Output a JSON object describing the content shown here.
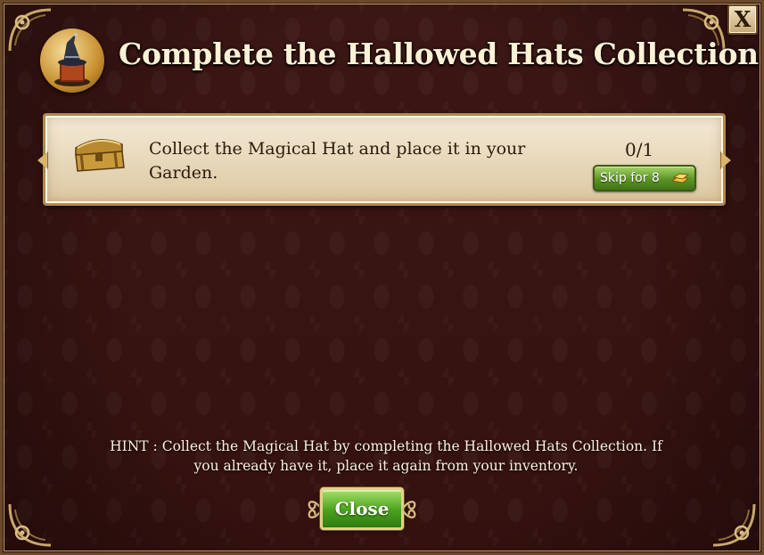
{
  "dialog": {
    "title": "Complete the Hallowed Hats Collection",
    "close_x_label": "X"
  },
  "task": {
    "text": "Collect the Magical Hat and place it in your Garden.",
    "progress": "0/1",
    "skip_label": "Skip for 8",
    "icon": "treasure-chest-icon"
  },
  "hint": {
    "text": "HINT : Collect the Magical Hat by completing the Hallowed Hats Collection.  If you already have it, place it again from your inventory."
  },
  "footer": {
    "close_label": "Close"
  },
  "colors": {
    "background": "#3a1513",
    "title_text": "#fdf2d6",
    "card_background": "#efe2c6",
    "button_green": "#4aa21e",
    "gold_border": "#b08a4e"
  }
}
